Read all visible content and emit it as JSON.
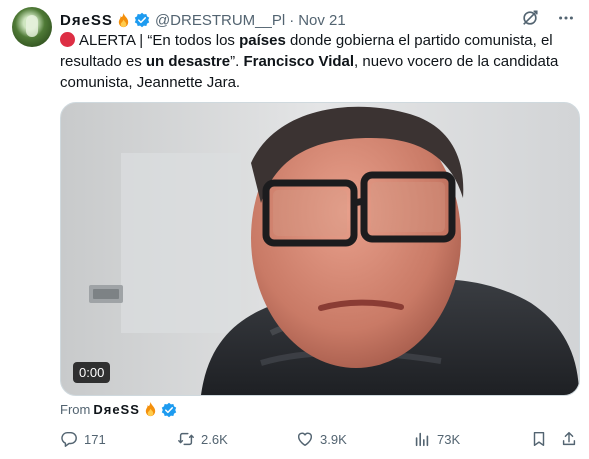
{
  "author": {
    "name": "DяeSS",
    "handle": "@DRESTRUM__Pl",
    "separator": "·",
    "date": "Nov 21"
  },
  "tweet": {
    "part1": "ALERTA | “En todos los ",
    "bold1": "países",
    "part2": " donde gobierna el partido comunista, el resultado es ",
    "bold2": "un desastre",
    "part3": "”. ",
    "bold3": "Francisco Vidal",
    "part4": ", nuevo vocero de la candidata comunista, Jeannette Jara."
  },
  "media": {
    "timestamp": "0:00"
  },
  "from": {
    "prefix": "From",
    "name": "DяeSS"
  },
  "actions": {
    "replies": "171",
    "reposts": "2.6K",
    "likes": "3.9K",
    "views": "73K"
  },
  "icons": {
    "top": [
      "grok-icon",
      "more-icon"
    ],
    "actions": [
      "reply-icon",
      "repost-icon",
      "like-icon",
      "views-icon",
      "bookmark-icon",
      "share-icon"
    ]
  },
  "colors": {
    "verified": "#1d9bf0",
    "secondary_text": "#536471",
    "alert": "#dd2e44"
  }
}
